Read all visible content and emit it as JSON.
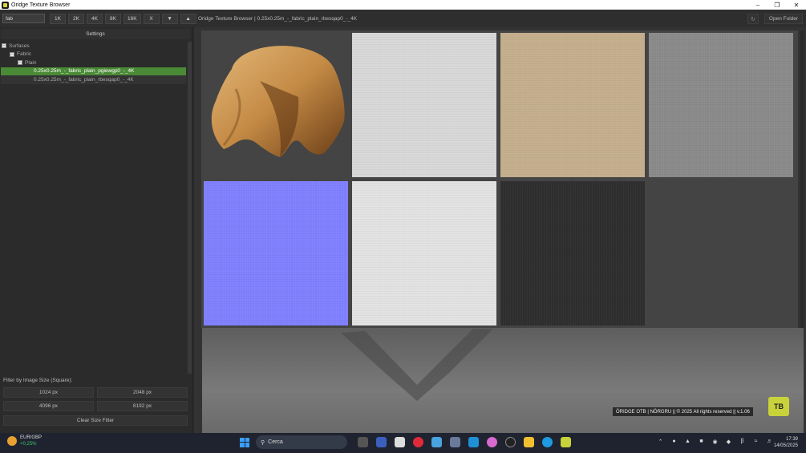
{
  "window": {
    "title": "Oridge Texture Browser"
  },
  "toolbar": {
    "search_value": "fab",
    "buttons": [
      "1K",
      "2K",
      "4K",
      "8K",
      "16K",
      "X",
      "▼",
      "▲"
    ],
    "path_label": "Oridge Texture Browser | 0.25x0.25m_-_fabric_plain_rbesqap0_-_4K",
    "open_folder": "Open Folder"
  },
  "sidebar": {
    "settings_label": "Settings",
    "tree": [
      {
        "label": "Surfaces",
        "box": "-"
      },
      {
        "label": "Fabric",
        "box": "-"
      },
      {
        "label": "Plain",
        "box": "-"
      },
      {
        "label": "0.25x0.25m_-_fabric_plain_pgiewgp0_-_4K",
        "selected": true
      },
      {
        "label": "0.25x0.25m_-_fabric_plain_rbesqap0_-_4K",
        "selected": false
      }
    ],
    "filter_label": "Filter by Image Size (Square):",
    "size_buttons": [
      "1024 px",
      "2048 px",
      "4096 px",
      "8192 px"
    ],
    "clear_filter": "Clear Size Filter"
  },
  "textures": {
    "tiles": [
      {
        "name": "preview",
        "color": "#444444"
      },
      {
        "name": "albedo-white",
        "color": "#d8d8d8"
      },
      {
        "name": "albedo-beige",
        "color": "#c4ae8c"
      },
      {
        "name": "roughness",
        "color": "#8a8a8a"
      },
      {
        "name": "normal",
        "color": "#8080ff"
      },
      {
        "name": "height",
        "color": "#e2e2e2"
      },
      {
        "name": "metallic",
        "color": "#2e2e2e"
      }
    ]
  },
  "footer": {
    "credit": "ÖRIDGE OTB | NÖRGRU || © 2025 All rights reserved || v.1.06",
    "logo_text": "TB"
  },
  "taskbar": {
    "weather_pair": "EUR/GBP",
    "weather_change": "+0,25%",
    "search_placeholder": "Cerca",
    "time": "17:39",
    "date": "14/05/2025"
  }
}
